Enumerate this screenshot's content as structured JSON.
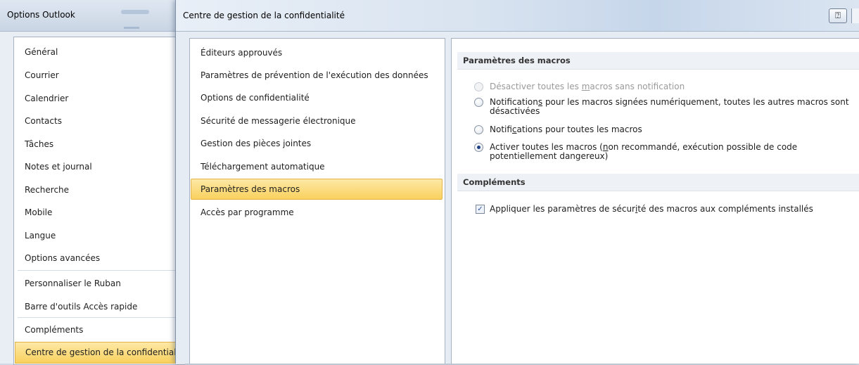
{
  "outlook": {
    "title": "Options Outlook",
    "nav": [
      {
        "label": "Général"
      },
      {
        "label": "Courrier"
      },
      {
        "label": "Calendrier"
      },
      {
        "label": "Contacts"
      },
      {
        "label": "Tâches"
      },
      {
        "label": "Notes et journal"
      },
      {
        "label": "Recherche"
      },
      {
        "label": "Mobile"
      },
      {
        "label": "Langue"
      },
      {
        "label": "Options avancées"
      },
      {
        "label": "Personnaliser le Ruban"
      },
      {
        "label": "Barre d'outils Accès rapide"
      },
      {
        "label": "Compléments"
      },
      {
        "label": "Centre de gestion de la confidentialité",
        "selected": true
      }
    ]
  },
  "trust": {
    "title": "Centre de gestion de la confidentialité",
    "help_icon": "question-mark-icon",
    "categories": [
      {
        "label": "Éditeurs approuvés"
      },
      {
        "label": "Paramètres de prévention de l'exécution des données"
      },
      {
        "label": "Options de confidentialité"
      },
      {
        "label": "Sécurité de messagerie électronique"
      },
      {
        "label": "Gestion des pièces jointes"
      },
      {
        "label": "Téléchargement automatique"
      },
      {
        "label": "Paramètres des macros",
        "selected": true
      },
      {
        "label": "Accès par programme"
      }
    ],
    "macros": {
      "heading": "Paramètres des macros",
      "options": [
        {
          "pre": "Désactiver toutes les ",
          "key": "m",
          "post": "acros sans notification",
          "checked": false,
          "disabled": true
        },
        {
          "pre": "Notification",
          "key": "s",
          "post": " pour les macros signées numériquement, toutes les autres macros sont désactivées",
          "checked": false,
          "disabled": false
        },
        {
          "pre": "Notifi",
          "key": "c",
          "post": "ations pour toutes les macros",
          "checked": false,
          "disabled": false
        },
        {
          "pre": "Activer toutes les macros (",
          "key": "n",
          "post": "on recommandé, exécution possible de code potentiellement dangereux)",
          "checked": true,
          "disabled": false
        }
      ]
    },
    "addins": {
      "heading": "Compléments",
      "checkbox": {
        "pre": "Appliquer les paramètres de sécur",
        "key": "i",
        "post": "té des macros aux compléments installés",
        "checked": true
      }
    }
  },
  "colors": {
    "selected_fill": "#f9d15e",
    "selected_border": "#e3b24b",
    "radio_dot": "#1d3f86"
  }
}
